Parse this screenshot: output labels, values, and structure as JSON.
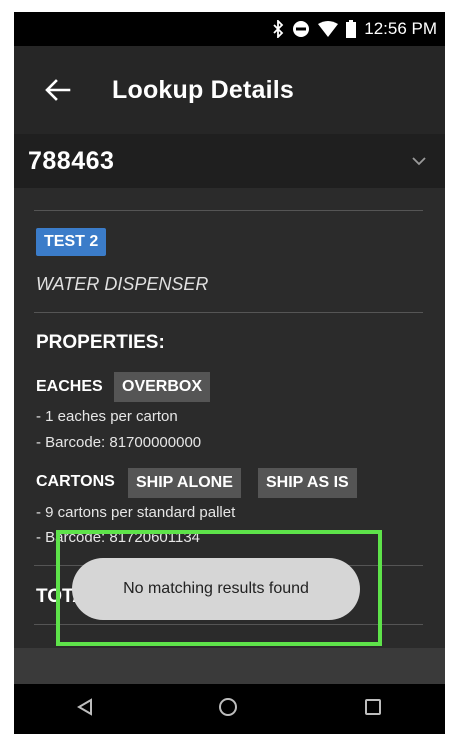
{
  "status_bar": {
    "time": "12:56 PM",
    "icons": [
      "bluetooth-icon",
      "do-not-disturb-icon",
      "wifi-icon",
      "battery-icon"
    ]
  },
  "app_bar": {
    "title": "Lookup Details",
    "back_icon": "arrow-left-icon"
  },
  "lookup": {
    "id": "788463",
    "expand_icon": "chevron-down-icon"
  },
  "item": {
    "badge": "TEST 2",
    "description": "WATER DISPENSER"
  },
  "properties": {
    "title": "PROPERTIES:",
    "eaches": {
      "label": "EACHES",
      "chips": [
        "OVERBOX"
      ],
      "lines": [
        "- 1 eaches per carton",
        "- Barcode: 81700000000"
      ]
    },
    "cartons": {
      "label": "CARTONS",
      "chips": [
        "SHIP ALONE",
        "SHIP AS IS"
      ],
      "lines": [
        "- 9 cartons per standard pallet",
        "- Barcode: 81720601134"
      ]
    }
  },
  "total": {
    "title": "TOTAL QTY:"
  },
  "toast": {
    "message": "No matching results found"
  },
  "nav_bar": {
    "icons": [
      "back-triangle-icon",
      "home-circle-icon",
      "recents-square-icon"
    ]
  },
  "colors": {
    "badge": "#3b7cc9",
    "highlight": "#5ee34a",
    "toast_bg": "#d6d6d6"
  }
}
